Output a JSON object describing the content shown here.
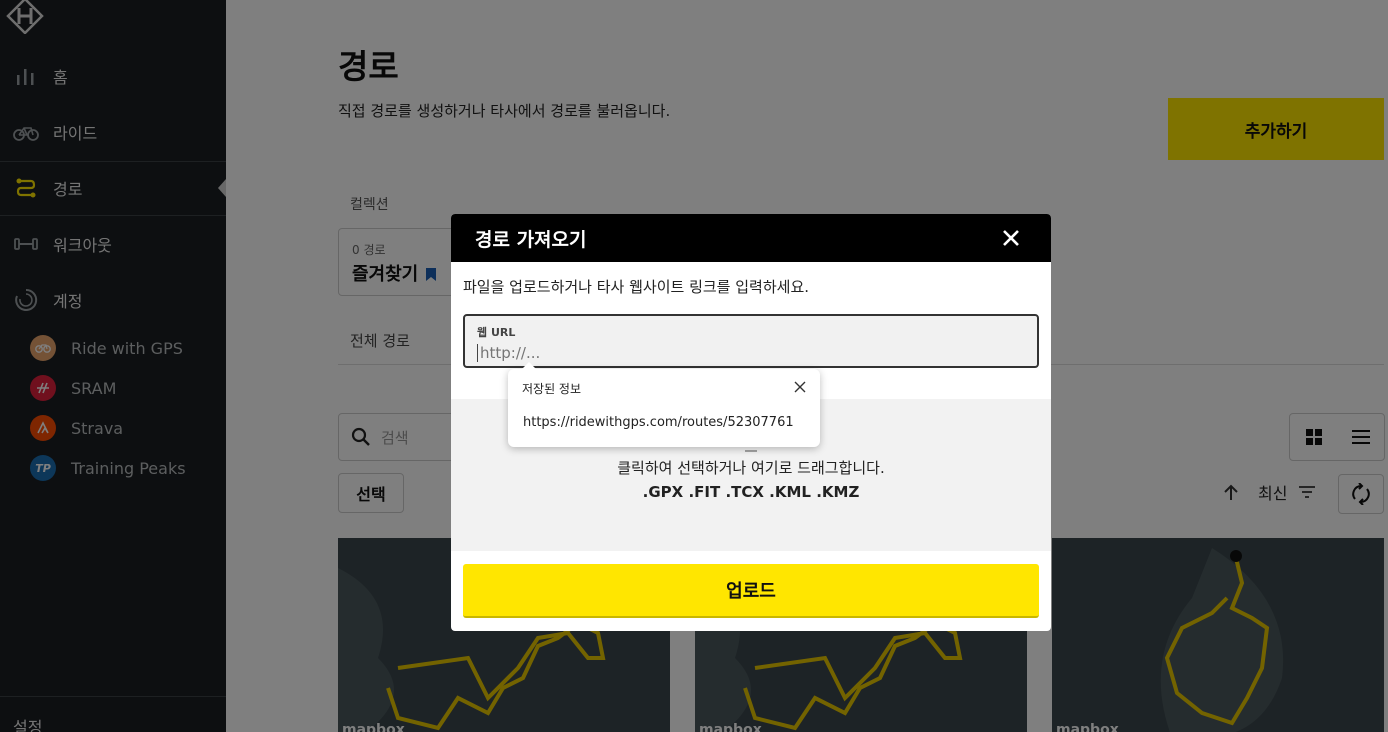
{
  "sidebar": {
    "nav": [
      {
        "label": "홈",
        "icon": "bar-chart-icon"
      },
      {
        "label": "라이드",
        "icon": "bicycle-icon"
      },
      {
        "label": "경로",
        "icon": "route-icon",
        "active": true
      },
      {
        "label": "워크아웃",
        "icon": "dumbbell-icon"
      },
      {
        "label": "계정",
        "icon": "account-icon"
      }
    ],
    "connections": [
      {
        "label": "Ride with GPS",
        "color": "#f4a460"
      },
      {
        "label": "SRAM",
        "color": "#e0203c"
      },
      {
        "label": "Strava",
        "color": "#fc4c02"
      },
      {
        "label": "Training Peaks",
        "color": "#1a6fb3",
        "badge": "TP"
      }
    ],
    "settings_label": "설정"
  },
  "main": {
    "title": "경로",
    "description": "직접 경로를 생성하거나 타사에서 경로를 불러옵니다.",
    "add_button": "추가하기",
    "collection_label": "컬렉션",
    "favorites": {
      "count": "0 경로",
      "name": "즐겨찾기"
    },
    "all_routes": "전체 경로",
    "search_placeholder": "검색",
    "select_button": "선택",
    "sort_label": "최신",
    "map_attribution": "mapbox"
  },
  "modal": {
    "title": "경로 가져오기",
    "instruction": "파일을 업로드하거나 타사 웹사이트 링크를 입력하세요.",
    "url_label": "웹 URL",
    "url_placeholder": "http://...",
    "drop_text": "클릭하여 선택하거나 여기로 드래그합니다.",
    "formats": ".GPX .FIT .TCX .KML .KMZ",
    "upload_button": "업로드"
  },
  "autocomplete": {
    "title": "저장된 정보",
    "suggestion": "https://ridewithgps.com/routes/52307761"
  },
  "colors": {
    "accent": "#ffe600",
    "sidebar_bg": "#1a1f22"
  }
}
